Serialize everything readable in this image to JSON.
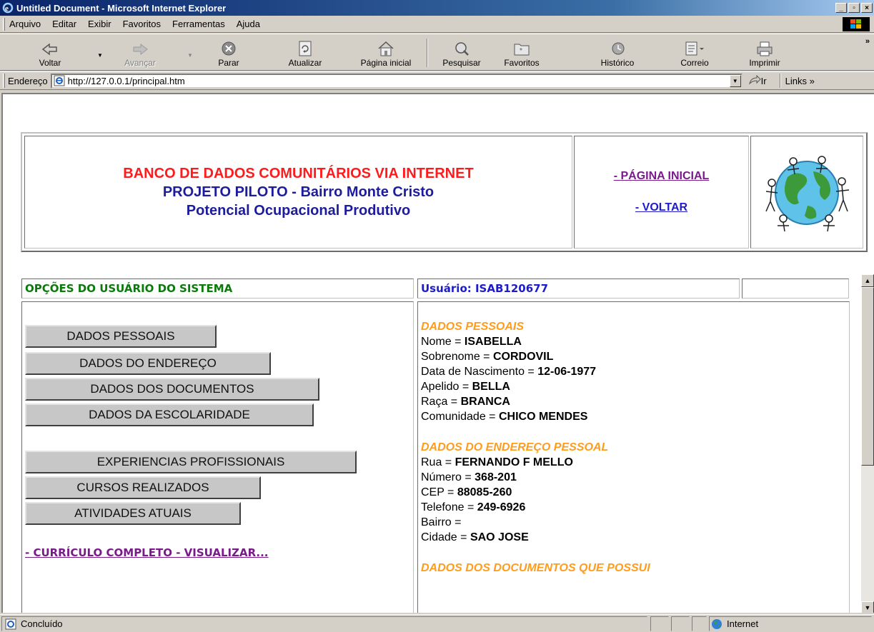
{
  "window": {
    "title": "Untitled Document - Microsoft Internet Explorer",
    "min": "_",
    "max": "▫",
    "close": "×"
  },
  "menu": [
    "Arquivo",
    "Editar",
    "Exibir",
    "Favoritos",
    "Ferramentas",
    "Ajuda"
  ],
  "toolbar": {
    "back": "Voltar",
    "forward": "Avançar",
    "stop": "Parar",
    "refresh": "Atualizar",
    "home": "Página inicial",
    "search": "Pesquisar",
    "favorites": "Favoritos",
    "history": "Histórico",
    "mail": "Correio",
    "print": "Imprimir",
    "more": "»"
  },
  "address": {
    "label": "Endereço",
    "url": "http://127.0.0.1/principal.htm",
    "go": "Ir",
    "links": "Links »"
  },
  "header": {
    "line1": "BANCO DE DADOS COMUNITÁRIOS VIA INTERNET",
    "line2": "PROJETO PILOTO - Bairro Monte Cristo",
    "line3": "Potencial Ocupacional Produtivo",
    "home_link": "- PÁGINA INICIAL",
    "back_link": "- VOLTAR"
  },
  "options": {
    "heading": "OPÇÕES DO USUÁRIO DO SISTEMA",
    "buttons": [
      "DADOS PESSOAIS",
      "DADOS DO ENDEREÇO",
      "DADOS DOS DOCUMENTOS",
      "DADOS DA ESCOLARIDADE",
      "EXPERIENCIAS PROFISSIONAIS",
      "CURSOS REALIZADOS",
      "ATIVIDADES ATUAIS"
    ],
    "cv_link": "- CURRÍCULO COMPLETO - VISUALIZAR..."
  },
  "user": {
    "label": "Usuário: ISAB120677"
  },
  "personal": {
    "title": "DADOS PESSOAIS",
    "rows": [
      {
        "k": "Nome = ",
        "v": "ISABELLA"
      },
      {
        "k": "Sobrenome = ",
        "v": "CORDOVIL"
      },
      {
        "k": "Data de Nascimento = ",
        "v": "12-06-1977"
      },
      {
        "k": "Apelido = ",
        "v": "BELLA"
      },
      {
        "k": "Raça = ",
        "v": "BRANCA"
      },
      {
        "k": "Comunidade = ",
        "v": "CHICO MENDES"
      }
    ]
  },
  "address_data": {
    "title": "DADOS DO ENDEREÇO PESSOAL",
    "rows": [
      {
        "k": "Rua = ",
        "v": "FERNANDO F MELLO"
      },
      {
        "k": "Número = ",
        "v": "368-201"
      },
      {
        "k": "CEP = ",
        "v": "88085-260"
      },
      {
        "k": "Telefone = ",
        "v": "249-6926"
      },
      {
        "k": "Bairro = ",
        "v": ""
      },
      {
        "k": "Cidade = ",
        "v": "SAO JOSE"
      }
    ]
  },
  "documents": {
    "title": "DADOS DOS DOCUMENTOS QUE POSSUI"
  },
  "status": {
    "text": "Concluído",
    "zone": "Internet"
  }
}
